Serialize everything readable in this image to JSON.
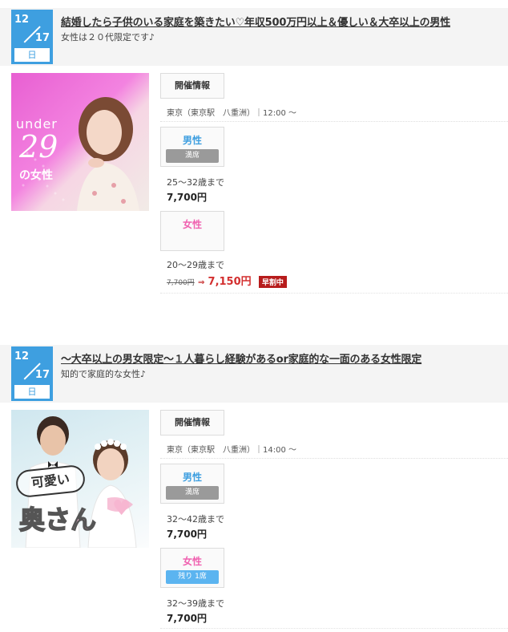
{
  "events": [
    {
      "date_month": "12",
      "date_day": "17",
      "weekday": "日",
      "title": "結婚したら子供のいる家庭を築きたい♡年収500万円以上＆優しい＆大卒以上の男性",
      "subtitle": "女性は２０代限定です♪",
      "thumb_text_top": "under",
      "thumb_text_num": "29",
      "thumb_text_bottom": "の女性",
      "info_label": "開催情報",
      "location": "東京（東京駅　八重洲）｜12:00 ～",
      "male": {
        "label": "男性",
        "badge": "満席",
        "age": "25～32歳まで",
        "price": "7,700円"
      },
      "female": {
        "label": "女性",
        "badge": "",
        "age": "20～29歳まで",
        "old_price": "7,700円",
        "arrow": "⇒",
        "new_price": "7,150円",
        "early": "早割中"
      }
    },
    {
      "date_month": "12",
      "date_day": "17",
      "weekday": "日",
      "title": "～大卒以上の男女限定～１人暮らし経験があるor家庭的な一面のある女性限定",
      "subtitle": "知的で家庭的な女性♪",
      "thumb_text_top": "可愛い",
      "thumb_text_bottom": "奥さん",
      "info_label": "開催情報",
      "location": "東京（東京駅　八重洲）｜14:00 ～",
      "male": {
        "label": "男性",
        "badge": "満席",
        "age": "32～42歳まで",
        "price": "7,700円"
      },
      "female": {
        "label": "女性",
        "badge": "残り 1席",
        "age": "32～39歳まで",
        "price": "7,700円"
      }
    }
  ],
  "colors": {
    "accent_blue": "#3e9fe0",
    "female_pink": "#f062b0",
    "sale_red": "#d32f2f"
  }
}
